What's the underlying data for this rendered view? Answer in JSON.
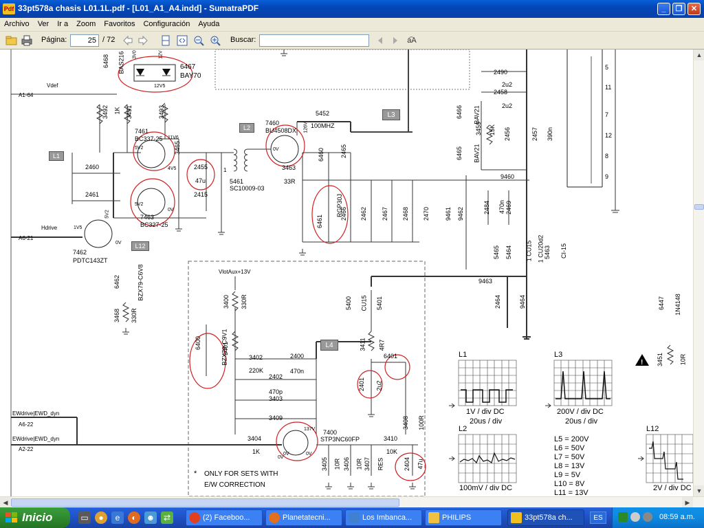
{
  "window": {
    "title": "33pt578a chasis L01.1L.pdf - [L01_A1_A4.indd] - SumatraPDF",
    "badge": "Pdf",
    "minimize": "_",
    "maximize": "❐",
    "close": "✕"
  },
  "menu": [
    "Archivo",
    "Ver",
    "Ir a",
    "Zoom",
    "Favoritos",
    "Configuración",
    "Ayuda"
  ],
  "toolbar": {
    "page_label": "Página:",
    "page_value": "25",
    "page_total": "/ 72",
    "search_label": "Buscar:",
    "search_value": "",
    "match_case": "a͡A"
  },
  "schematic": {
    "labels": {
      "vdef": "Vdef",
      "a164": "A1-64",
      "hdrive": "Hdrive",
      "a621": "A6-21",
      "ewdrive1": "EWdrive|EWD_dyn",
      "a622": "A6-22",
      "ewdrive2": "EWdrive|EWD_dyn",
      "a222": "A2-22",
      "vlotaux": "VlotAux+13V",
      "note_star": "*",
      "note1": "ONLY FOR SETS WITH",
      "note2": "E/W CORRECTION"
    },
    "tags": [
      "L1",
      "L2",
      "L3",
      "L4",
      "L12"
    ],
    "components": {
      "c6468": "6468",
      "c6467": "6467",
      "bay70": "BAY70",
      "bas216": "BAS216",
      "c3492": "3492",
      "c3491": "3491",
      "r1k": "1K",
      "c3493": "3493",
      "c7461": "7461",
      "bc337": "BC337-25",
      "c7463": "7463",
      "bc327": "BC327-25",
      "c7462": "7462",
      "pdtc": "PDTC143ZT",
      "c2460": "2460",
      "c2461": "2461",
      "c2455": "2455",
      "u47": "47u",
      "c2415": "2415",
      "c3465": "3465",
      "c5461": "5461",
      "sc": "SC10009-03",
      "c7460": "7460",
      "bu4508": "BU4508DX",
      "c3463": "3463",
      "r33": "33R",
      "c5452": "5452",
      "mhz": "100MHZ",
      "c6460": "6460",
      "c2465": "2465",
      "c6461": "6461",
      "rgp": "RGP30J",
      "c2466": "2466",
      "c2462": "2462",
      "c2467": "2467",
      "c2468": "2468",
      "c2470": "2470",
      "c9461": "9461",
      "c9462": "9462",
      "c2490": "2490",
      "c2u2a": "2u2",
      "c2458": "2458",
      "c2u2b": "2u2",
      "c6466": "6466",
      "bav21a": "BAV21",
      "c3459": "3459",
      "k15": "15K",
      "c6465": "6465",
      "bav21b": "BAV21",
      "c2456": "2456",
      "c2457": "2457",
      "n390": "390n",
      "c9460": "9460",
      "c2484": "2484",
      "n470": "470n",
      "c2469": "2469",
      "c5465": "5465",
      "c5464": "5464",
      "cu15a": "1 CU15",
      "cu20d2": "1 CU20d2",
      "c5463": "5463",
      "ci15": "CI-15",
      "c9463": "9463",
      "c2464": "2464",
      "c9464": "9464",
      "c6447": "6447",
      "n4148": "1N4148",
      "c3451": "3451",
      "r10": "10R",
      "c6462": "6462",
      "bzx79": "BZX79-C6V8",
      "c3468": "3468",
      "r330a": "330R",
      "c3400": "3400",
      "r330b": "330R",
      "c6400": "6400",
      "bzx79b": "BZX79-C9V1",
      "c3401": "3401",
      "c3402": "3402",
      "k220": "220K",
      "c2400": "2400",
      "n470b": "470n",
      "c2402": "2402",
      "p470": "470p",
      "c3403": "3403",
      "c3409": "3409",
      "c7400": "7400",
      "stp": "STP3NC60FP",
      "c3404": "3404",
      "k1": "1K",
      "c3410": "3410",
      "k10": "10K",
      "c5400": "5400",
      "cu15b": "CU15",
      "c5401": "5401",
      "c3411": "3411",
      "r4r7": "4R7",
      "c6401": "6401",
      "c2401": "2401",
      "u2u2": "2u2",
      "c3408": "3408",
      "r100": "100R",
      "c3405": "3405",
      "r10a": "10R",
      "c3406": "3406",
      "r10b": "10R",
      "c3407": "3407",
      "res": "RES",
      "c2404": "2404",
      "u47b": "47u"
    },
    "voltages": [
      "3V0",
      "12V",
      "12V5",
      "5V2",
      "11V6",
      "4V5",
      "5V2",
      "0V",
      "0V",
      "1V5",
      "5V2",
      "0V",
      "126V",
      "0V",
      "137V",
      "0V",
      "0V",
      "1"
    ]
  },
  "scopes": [
    {
      "tag": "L1",
      "caption": "1V / div DC",
      "sub": "20us / div"
    },
    {
      "tag": "L3",
      "caption": "200V / div DC",
      "sub": "20us / div"
    },
    {
      "tag": "L2",
      "caption": "100mV / div DC",
      "sub": ""
    },
    {
      "tag": "L12",
      "caption": "2V / div DC",
      "sub": ""
    }
  ],
  "voltage_table": [
    "L5 = 200V",
    "L6 = 50V",
    "L7 = 50V",
    "L8 = 13V",
    "L9 = 5V",
    "L10 = 8V",
    "L11 = 13V"
  ],
  "connector_pins": [
    "5",
    "11",
    "7",
    "12",
    "8",
    "9"
  ],
  "taskbar": {
    "start": "Inicio",
    "tasks": [
      {
        "label": "(2) Faceboo...",
        "color": "#e04020"
      },
      {
        "label": "Planetatecni...",
        "color": "#e07020"
      },
      {
        "label": "Los Imbanca...",
        "color": "#4080d0"
      },
      {
        "label": "PHILIPS",
        "color": "#f0c040"
      },
      {
        "label": "33pt578a ch...",
        "color": "#f0c020",
        "active": true
      }
    ],
    "lang": "ES",
    "clock": "08:59 a.m."
  }
}
